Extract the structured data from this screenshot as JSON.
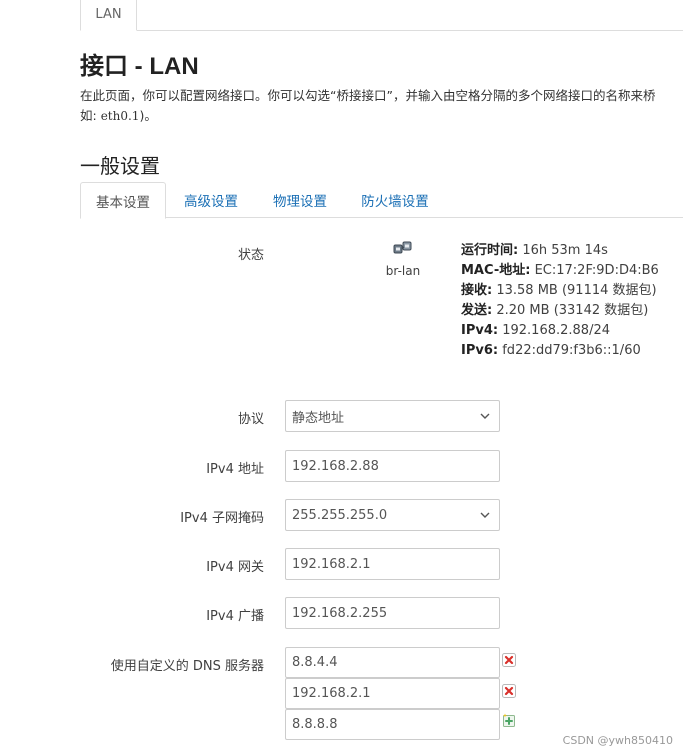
{
  "top_tab": {
    "label": "LAN"
  },
  "page": {
    "title": "接口 - LAN",
    "description_line1": "在此页面，你可以配置网络接口。你可以勾选“桥接接口”，并输入由空格分隔的多个网络接口的名称来桥",
    "description_line2_prefix": "如: ",
    "description_line2_code": "eth0.1",
    "description_line2_suffix": ")。"
  },
  "section": {
    "title": "一般设置"
  },
  "tabs": [
    {
      "label": "基本设置",
      "active": true
    },
    {
      "label": "高级设置",
      "active": false
    },
    {
      "label": "物理设置",
      "active": false
    },
    {
      "label": "防火墙设置",
      "active": false
    }
  ],
  "status": {
    "label": "状态",
    "interface_icon": "network-ports-icon",
    "interface_name": "br-lan",
    "rows": [
      {
        "key": "运行时间:",
        "value": "16h 53m 14s"
      },
      {
        "key": "MAC-地址:",
        "value": "EC:17:2F:9D:D4:B6"
      },
      {
        "key": "接收:",
        "value": "13.58 MB (91114 数据包)"
      },
      {
        "key": "发送:",
        "value": "2.20 MB (33142 数据包)"
      },
      {
        "key": "IPv4:",
        "value": "192.168.2.88/24"
      },
      {
        "key": "IPv6:",
        "value": "fd22:dd79:f3b6::1/60"
      }
    ]
  },
  "form": {
    "protocol": {
      "label": "协议",
      "value": "静态地址"
    },
    "ipv4_address": {
      "label": "IPv4 地址",
      "value": "192.168.2.88"
    },
    "ipv4_netmask": {
      "label": "IPv4 子网掩码",
      "value": "255.255.255.0"
    },
    "ipv4_gateway": {
      "label": "IPv4 网关",
      "value": "192.168.2.1"
    },
    "ipv4_broadcast": {
      "label": "IPv4 广播",
      "value": "192.168.2.255"
    },
    "dns": {
      "label": "使用自定义的 DNS 服务器",
      "servers": [
        "8.8.4.4",
        "192.168.2.1",
        "8.8.8.8"
      ]
    }
  },
  "colors": {
    "link": "#1a6fb5",
    "remove": "#d9302b",
    "add": "#4aa564"
  },
  "watermark": "CSDN @ywh850410"
}
